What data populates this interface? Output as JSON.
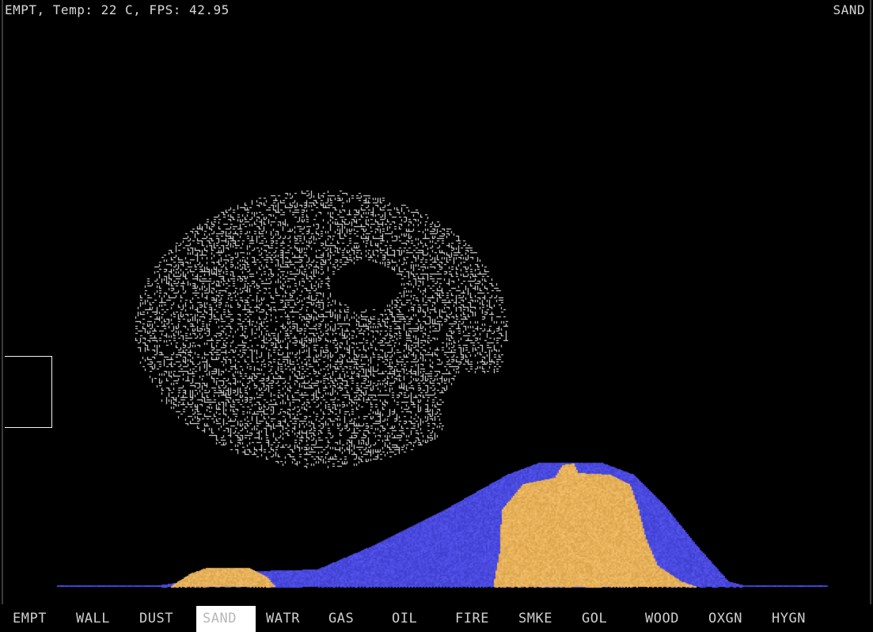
{
  "status": {
    "text": "EMPT, Temp: 22 C, FPS: 42.95",
    "selected": "SAND"
  },
  "toolbar": {
    "items": [
      {
        "label": "EMPT",
        "selected": false
      },
      {
        "label": "WALL",
        "selected": false
      },
      {
        "label": "DUST",
        "selected": false
      },
      {
        "label": "SAND",
        "selected": true
      },
      {
        "label": "WATR",
        "selected": false
      },
      {
        "label": "GAS",
        "selected": false
      },
      {
        "label": "OIL",
        "selected": false
      },
      {
        "label": "FIRE",
        "selected": false
      },
      {
        "label": "SMKE",
        "selected": false
      },
      {
        "label": "GOL",
        "selected": false
      },
      {
        "label": "WOOD",
        "selected": false
      },
      {
        "label": "OXGN",
        "selected": false
      },
      {
        "label": "HYGN",
        "selected": false
      }
    ]
  },
  "colors": {
    "background": "#000000",
    "water": "#4848dc",
    "sand": "#e8b25a",
    "life_cells": "#ffffff",
    "selected_tool_bg": "#ffffff"
  }
}
